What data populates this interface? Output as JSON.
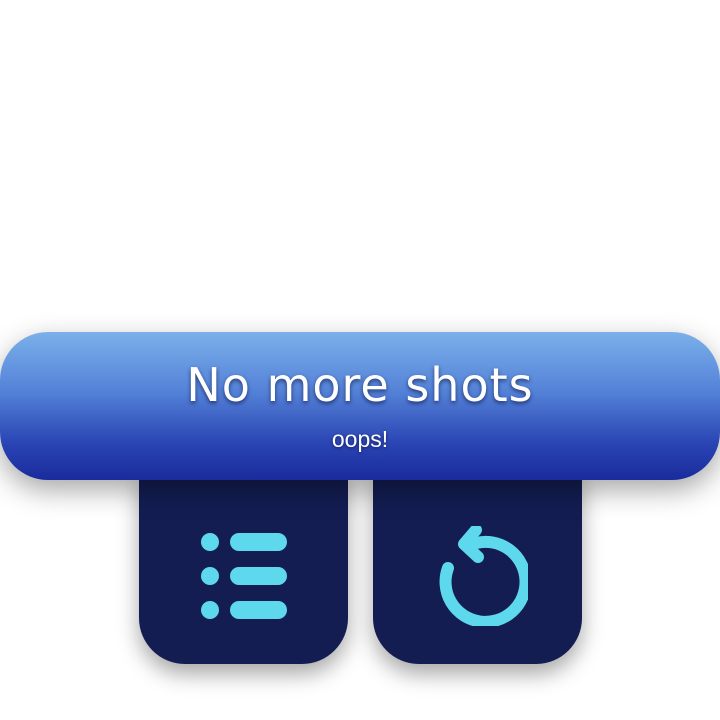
{
  "banner": {
    "title": "No more shots",
    "subtitle": "oops!"
  },
  "buttons": [
    {
      "name": "level-list",
      "icon": "list-icon"
    },
    {
      "name": "retry",
      "icon": "restart-icon"
    }
  ],
  "colors": {
    "banner_top": "#7bb0ea",
    "banner_bottom": "#1a2b9c",
    "button_bg": "#131d52",
    "icon": "#5ed8ec"
  }
}
